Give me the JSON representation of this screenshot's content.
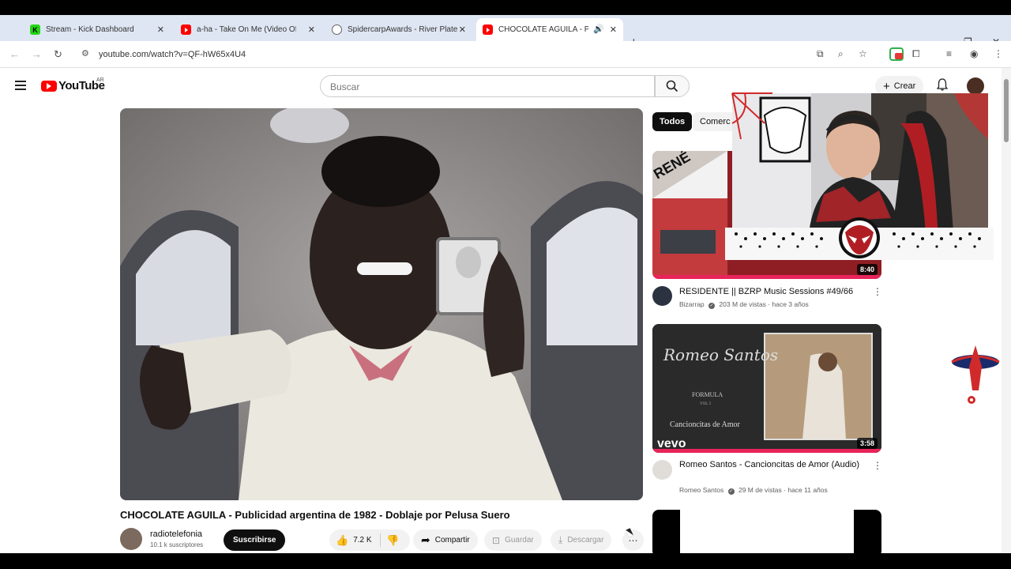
{
  "browser": {
    "tabs": [
      {
        "title": "Stream - Kick Dashboard",
        "favicon": "K",
        "favicon_color": "#24d515"
      },
      {
        "title": "a-ha - Take On Me (Video Ofic",
        "favicon": "",
        "favicon_color": "#ff0000"
      },
      {
        "title": "SpidercarpAwards - River Plate",
        "favicon": "",
        "favicon_color": "#5f6368"
      },
      {
        "title": "CHOCOLATE AGUILA - Publ",
        "favicon": "",
        "favicon_color": "#ff0000"
      }
    ],
    "url": "youtube.com/watch?v=QF-hW65x4U4"
  },
  "youtube": {
    "logo_text": "YouTube",
    "region": "AR",
    "search_placeholder": "Buscar",
    "create_label": "Crear",
    "video": {
      "title": "CHOCOLATE AGUILA - Publicidad argentina de 1982 - Doblaje por Pelusa Suero",
      "channel": "radiotelefonia",
      "subscribers": "10.1 k suscriptores",
      "subscribe_label": "Suscribirse",
      "likes": "7.2 K",
      "share_label": "Compartir",
      "save_label": "Guardar",
      "download_label": "Descargar"
    },
    "chips": [
      "Todos",
      "Comerc"
    ],
    "recommendations": [
      {
        "title": "RESIDENTE || BZRP Music Sessions #49/66",
        "channel": "Bizarrap",
        "meta": "203 M de vistas · hace 3 años",
        "duration": "8:40",
        "thumb_text": "RENÉ"
      },
      {
        "title": "Romeo Santos - Cancioncitas de Amor (Audio)",
        "channel": "Romeo Santos",
        "meta": "29 M de vistas · hace 11 años",
        "duration": "3:58",
        "thumb_artist": "Romeo Santos",
        "thumb_album_label": "FORMULA",
        "thumb_album_vol": "VOL 3",
        "thumb_song": "Cancioncitas de Amor",
        "thumb_brand": "vevo"
      }
    ]
  }
}
